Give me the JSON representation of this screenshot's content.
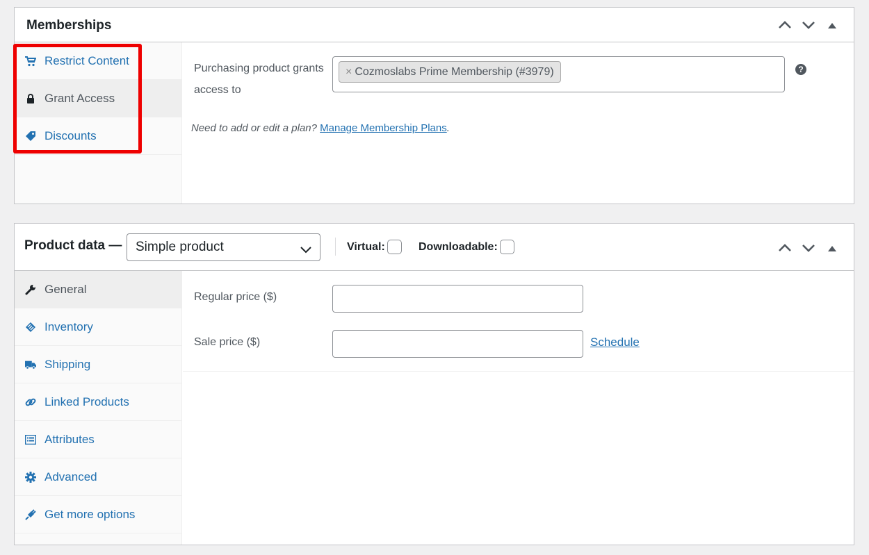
{
  "memberships": {
    "title": "Memberships",
    "tabs": [
      {
        "label": "Restrict Content",
        "icon": "cart-icon"
      },
      {
        "label": "Grant Access",
        "icon": "lock-icon"
      },
      {
        "label": "Discounts",
        "icon": "tag-icon"
      }
    ],
    "grant_label": "Purchasing product grants access to",
    "grant_value": "Cozmoslabs Prime Membership (#3979)",
    "chip_remove": "×",
    "help": "?",
    "note_text": "Need to add or edit a plan?",
    "note_link": "Manage Membership Plans",
    "note_end": "."
  },
  "product_data": {
    "title": "Product data —",
    "type_selected": "Simple product",
    "virtual_label": "Virtual:",
    "downloadable_label": "Downloadable:",
    "tabs": [
      {
        "label": "General",
        "icon": "wrench-icon"
      },
      {
        "label": "Inventory",
        "icon": "inventory-icon"
      },
      {
        "label": "Shipping",
        "icon": "truck-icon"
      },
      {
        "label": "Linked Products",
        "icon": "link-icon"
      },
      {
        "label": "Attributes",
        "icon": "list-icon"
      },
      {
        "label": "Advanced",
        "icon": "gear-icon"
      },
      {
        "label": "Get more options",
        "icon": "plugin-icon"
      }
    ],
    "regular_price_label": "Regular price ($)",
    "sale_price_label": "Sale price ($)",
    "regular_price_value": "",
    "sale_price_value": "",
    "schedule_link": "Schedule"
  },
  "colors": {
    "link": "#2271b1",
    "highlight": "#ee0000",
    "text": "#50575e"
  }
}
